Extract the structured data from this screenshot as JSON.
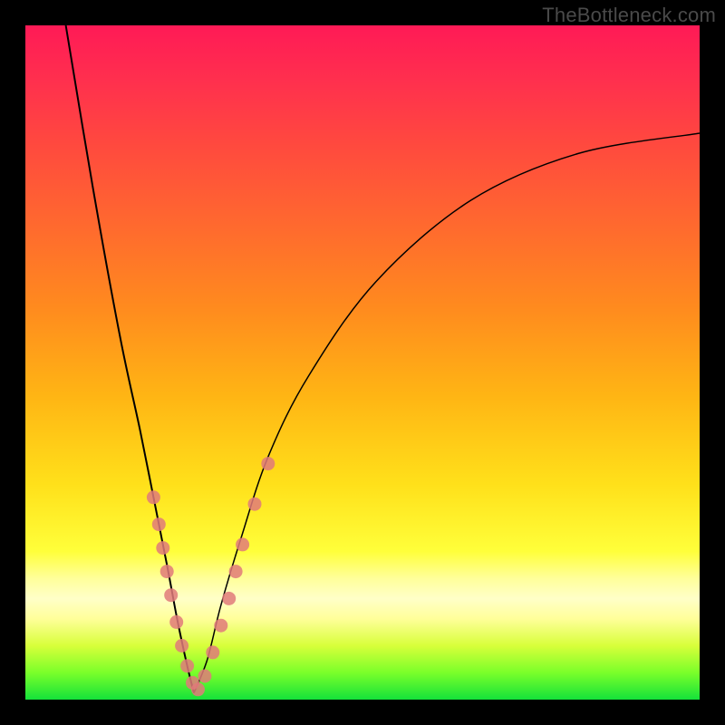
{
  "watermark": "TheBottleneck.com",
  "colors": {
    "frame": "#000000",
    "gradient_top": "#ff1a56",
    "gradient_mid": "#ffe01a",
    "gradient_bottom": "#14e23a",
    "curve": "#000000",
    "dots": "#e07a7a"
  },
  "chart_data": {
    "type": "line",
    "title": "",
    "xlabel": "",
    "ylabel": "",
    "xlim": [
      0,
      100
    ],
    "ylim": [
      0,
      100
    ],
    "notes": "Valley-shaped bottleneck curve on red→green gradient background. Two branches meeting at a minimum near x≈25. Salmon dots mark sampled points along the lower portion of both branches.",
    "series": [
      {
        "name": "left-branch",
        "x": [
          6,
          10,
          14,
          17,
          19,
          21,
          22.5,
          24,
          25
        ],
        "y": [
          100,
          76,
          54,
          40,
          30,
          20,
          12,
          5,
          1
        ]
      },
      {
        "name": "right-branch",
        "x": [
          25,
          27,
          29,
          32,
          36,
          42,
          52,
          66,
          82,
          100
        ],
        "y": [
          1,
          6,
          14,
          24,
          36,
          48,
          62,
          74,
          81,
          84
        ]
      }
    ],
    "dots": {
      "name": "sample-points",
      "color": "#e07a7a",
      "x": [
        19.0,
        19.8,
        20.4,
        21.0,
        21.6,
        22.4,
        23.2,
        24.0,
        24.8,
        25.6,
        26.6,
        27.8,
        29.0,
        30.2,
        31.2,
        32.2,
        34.0,
        36.0
      ],
      "y": [
        30.0,
        26.0,
        22.5,
        19.0,
        15.5,
        11.5,
        8.0,
        5.0,
        2.5,
        1.5,
        3.5,
        7.0,
        11.0,
        15.0,
        19.0,
        23.0,
        29.0,
        35.0
      ]
    }
  }
}
